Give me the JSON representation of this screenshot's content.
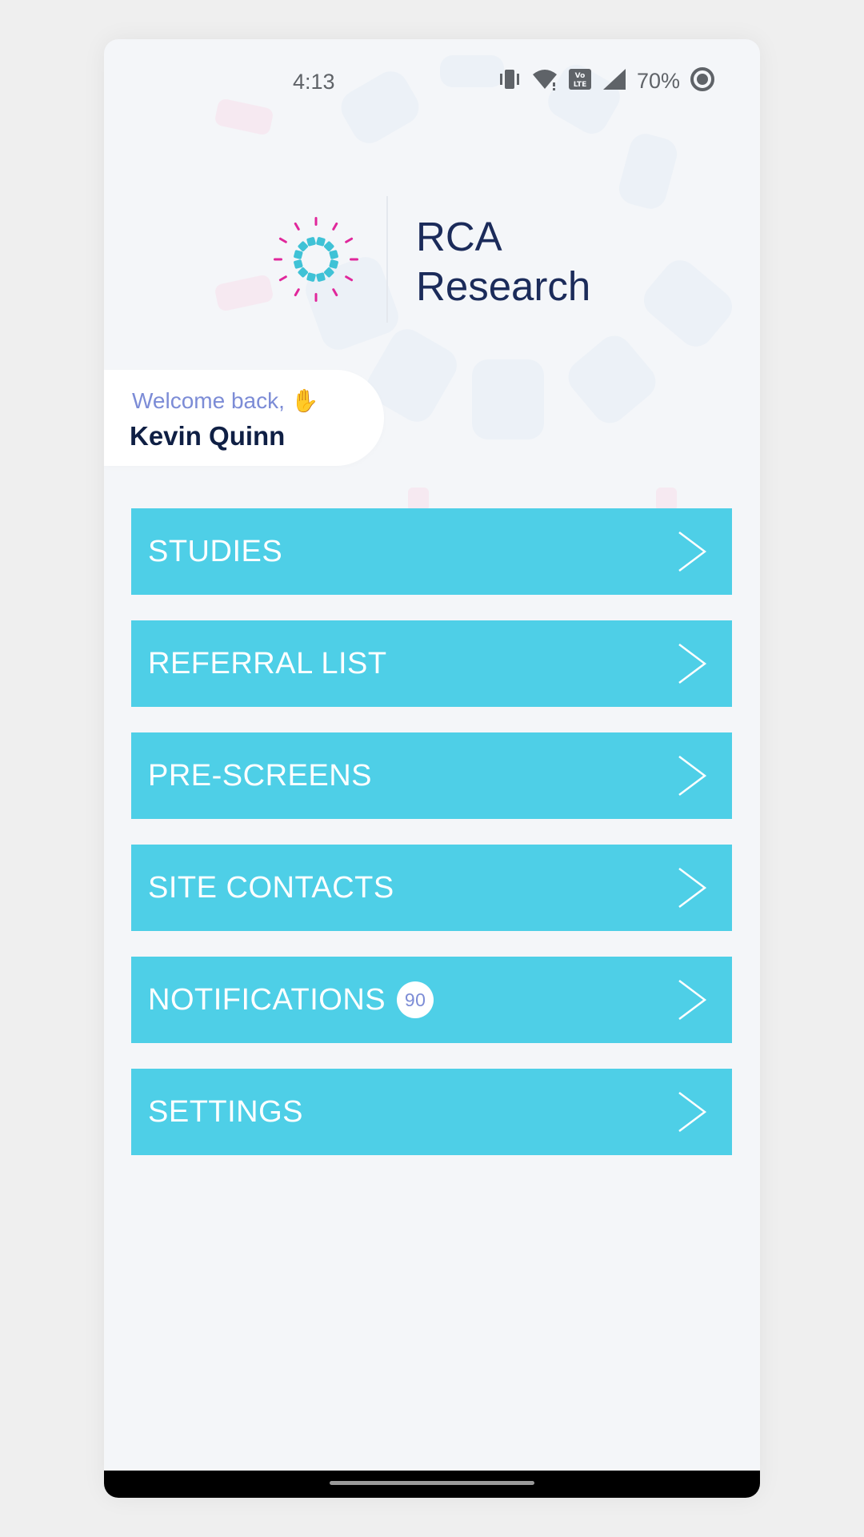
{
  "status_bar": {
    "time": "4:13",
    "battery": "70%",
    "icons": [
      "vibrate-icon",
      "wifi-icon",
      "volte-icon",
      "signal-icon",
      "battery-icon"
    ]
  },
  "brand": {
    "line1": "RCA",
    "line2": "Research",
    "colors": {
      "dark": "#1b2b5a",
      "teal": "#3fc2d6",
      "magenta": "#e0279b"
    }
  },
  "welcome": {
    "greeting": "Welcome back, ✋",
    "name": "Kevin Quinn"
  },
  "menu": {
    "accent": "#4ecfe7",
    "items": [
      {
        "label": "STUDIES"
      },
      {
        "label": "REFERRAL LIST"
      },
      {
        "label": "PRE-SCREENS"
      },
      {
        "label": "SITE CONTACTS"
      },
      {
        "label": "NOTIFICATIONS",
        "badge": "90"
      },
      {
        "label": "SETTINGS"
      }
    ]
  }
}
